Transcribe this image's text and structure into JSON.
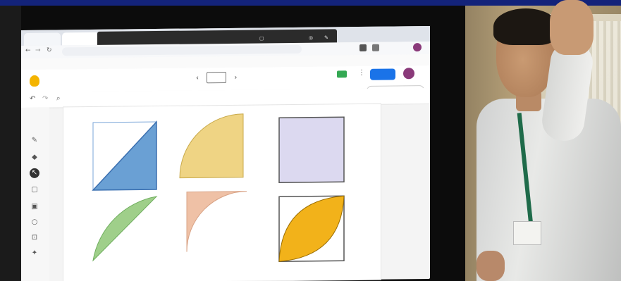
{
  "browser": {
    "tabs": [
      "",
      ""
    ],
    "share_banner_text": "",
    "share_banner_action": "",
    "url": "",
    "bookmarks": ""
  },
  "jamboard": {
    "title": "",
    "share_label": "",
    "jamboard_badge": "",
    "toolbar_items": [
      "",
      ""
    ]
  },
  "canvas": {
    "shapes": [
      {
        "name": "right-triangle",
        "fill": "#6aa0d4"
      },
      {
        "name": "quarter-circle",
        "fill": "#efd484"
      },
      {
        "name": "square",
        "fill": "#dcd9f0"
      },
      {
        "name": "green-segment",
        "fill": "#9fcf8a"
      },
      {
        "name": "pink-corner",
        "fill": "#efc1a6"
      },
      {
        "name": "lens-in-square",
        "fill": "#f2b21a"
      }
    ]
  },
  "colors": {
    "screen_bg": "#f4f4f4",
    "share_button": "#1a73e8",
    "top_band": "#13237a"
  }
}
